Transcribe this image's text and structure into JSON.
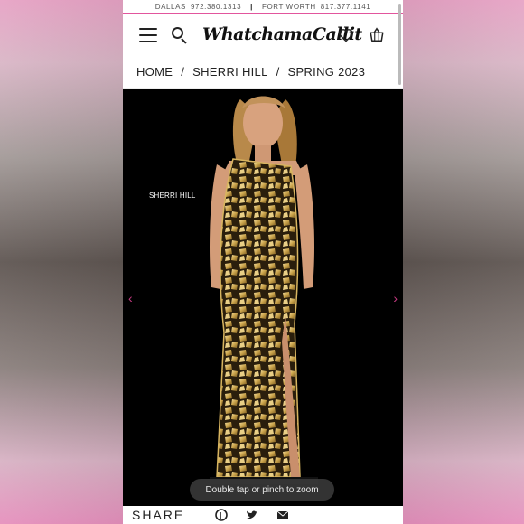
{
  "topbar": {
    "dallas_label": "DALLAS",
    "dallas_phone": "972.380.1313",
    "separator": "|",
    "fortworth_label": "FORT WORTH",
    "fortworth_phone": "817.377.1141"
  },
  "header": {
    "logo_text": "WhatchamaCallit",
    "icons": [
      "menu-icon",
      "search-icon",
      "heart-icon",
      "bag-icon"
    ]
  },
  "breadcrumb": {
    "items": [
      "HOME",
      "SHERRI HILL",
      "SPRING 2023"
    ],
    "separator": "/"
  },
  "gallery": {
    "brand_tag": "SHERRI HILL",
    "prev_arrow": "‹",
    "next_arrow": "›",
    "zoom_hint": "Double tap or pinch to zoom"
  },
  "share": {
    "label": "SHARE",
    "icons": [
      "pinterest-icon",
      "twitter-icon",
      "email-icon"
    ]
  },
  "colors": {
    "accent": "#e2559d",
    "gallery_bg": "#000000",
    "dress_gold": "#c9a24a"
  }
}
